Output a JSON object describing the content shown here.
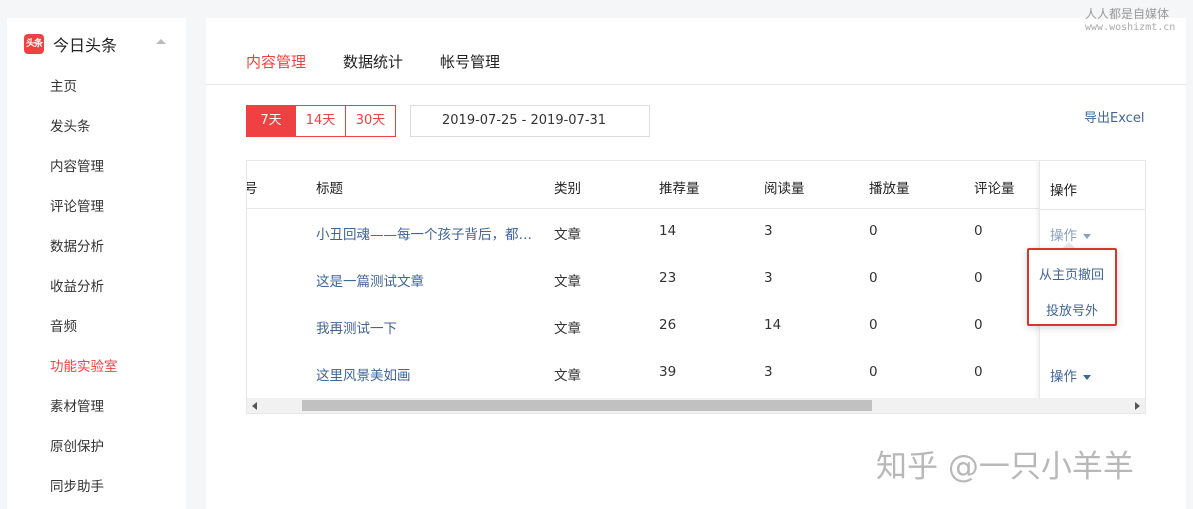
{
  "sidebar": {
    "brand": {
      "logo_text": "头条",
      "name": "今日头条"
    },
    "items": [
      {
        "label": "主页"
      },
      {
        "label": "发头条"
      },
      {
        "label": "内容管理"
      },
      {
        "label": "评论管理"
      },
      {
        "label": "数据分析"
      },
      {
        "label": "收益分析"
      },
      {
        "label": "音频"
      },
      {
        "label": "功能实验室"
      },
      {
        "label": "素材管理"
      },
      {
        "label": "原创保护"
      },
      {
        "label": "同步助手"
      }
    ],
    "active_index": 7
  },
  "tabs": [
    {
      "label": "内容管理"
    },
    {
      "label": "数据统计"
    },
    {
      "label": "帐号管理"
    }
  ],
  "toolbar": {
    "ranges": [
      "7天",
      "14天",
      "30天"
    ],
    "date_range": "2019-07-25 - 2019-07-31",
    "export_label": "导出Excel"
  },
  "table": {
    "partial_first_header": "号",
    "headers": [
      "标题",
      "类别",
      "推荐量",
      "阅读量",
      "播放量",
      "评论量"
    ],
    "action_header": "操作",
    "rows": [
      {
        "title": "小丑回魂——每一个孩子背后，都有一个...",
        "type": "文章",
        "recommend": "14",
        "read": "3",
        "play": "0",
        "comment": "0"
      },
      {
        "title": "这是一篇测试文章",
        "type": "文章",
        "recommend": "23",
        "read": "3",
        "play": "0",
        "comment": "0"
      },
      {
        "title": "我再测试一下",
        "type": "文章",
        "recommend": "26",
        "read": "14",
        "play": "0",
        "comment": "0"
      },
      {
        "title": "这里风景美如画",
        "type": "文章",
        "recommend": "39",
        "read": "3",
        "play": "0",
        "comment": "0"
      }
    ],
    "action_label": "操作"
  },
  "dropdown": {
    "items": [
      "从主页撤回",
      "投放号外"
    ]
  },
  "watermark": {
    "top": "人人都是自媒体",
    "top_sub": "www.woshizmt.cn",
    "bottom": "知乎 @一只小羊羊"
  },
  "colors": {
    "accent": "#f04142",
    "link": "#406599",
    "highlight_border": "#d9352c"
  }
}
